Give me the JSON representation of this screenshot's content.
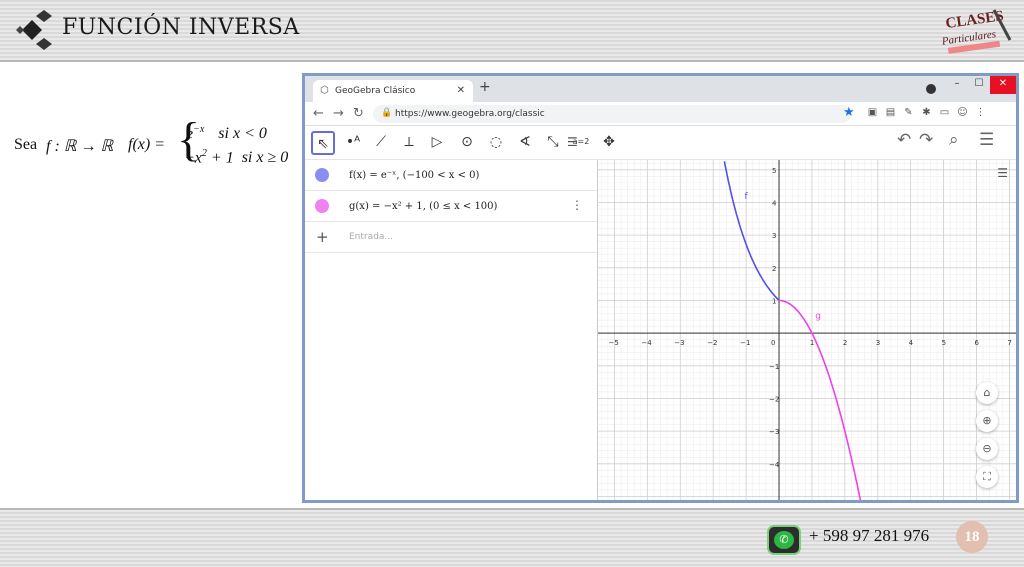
{
  "slide": {
    "title": "FUNCIÓN INVERSA",
    "formula": {
      "sea": "Sea",
      "map": "f : ℝ → ℝ",
      "fx": "f(x) =",
      "case1_expr": "e",
      "case1_exp": "−x",
      "case1_cond": "si   x < 0",
      "case2_expr": "−x",
      "case2_exp": "2",
      "case2_rest": " + 1",
      "case2_cond": "si   x ≥ 0"
    },
    "brand_text": [
      "CLASES",
      "Particulares"
    ],
    "contact_phone": "+ 598 97 281 976",
    "page_number": "18"
  },
  "browser": {
    "tab_title": "GeoGebra Clásico",
    "url": "https://www.geogebra.org/classic"
  },
  "geogebra": {
    "algebra": [
      {
        "expr": "f(x) = e⁻ˣ,   (−100 < x < 0)",
        "color": "#7b7bf0"
      },
      {
        "expr": "g(x) = −x² + 1,   (0 ≤ x < 100)",
        "color": "#ee82ee"
      }
    ],
    "input_placeholder": "Entrada...",
    "tool_icons": [
      "move-icon",
      "point-icon",
      "line-icon",
      "perpendicular-icon",
      "polygon-icon",
      "circle-center-icon",
      "circle-three-points-icon",
      "angle-icon",
      "reflect-icon",
      "slider-icon",
      "move-view-icon"
    ],
    "graph": {
      "x_ticks": [
        -5,
        -4,
        -3,
        -2,
        -1,
        0,
        1,
        2,
        3,
        4,
        5,
        6,
        7
      ],
      "y_ticks": [
        5,
        4,
        3,
        2,
        1,
        -1,
        -2,
        -3,
        -4
      ],
      "x_range": [
        -5.5,
        7.2
      ],
      "y_range": [
        -5.2,
        5.3
      ],
      "curve_f": {
        "label": "f",
        "color": "#5050e6"
      },
      "curve_g": {
        "label": "g",
        "color": "#ee40ee"
      }
    }
  }
}
